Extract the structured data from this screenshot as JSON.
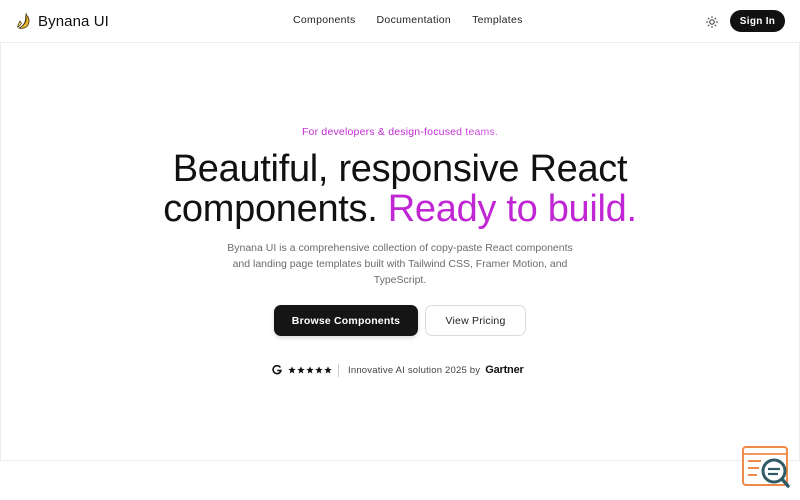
{
  "brand": {
    "name": "Bynana UI",
    "logo_icon": "banana-logo-icon"
  },
  "nav": {
    "links": [
      {
        "label": "Components"
      },
      {
        "label": "Documentation"
      },
      {
        "label": "Templates"
      }
    ],
    "theme_icon": "sun-icon",
    "signin_label": "Sign In"
  },
  "hero": {
    "tagline": "For developers & design-focused teams.",
    "headline_line1": "Beautiful, responsive React",
    "headline_line2_plain": "components.",
    "headline_line2_accent": "Ready to build.",
    "description": "Bynana UI is a comprehensive collection of copy-paste React components and landing page templates built with Tailwind CSS, Framer Motion, and TypeScript.",
    "primary_cta": "Browse Components",
    "secondary_cta": "View Pricing"
  },
  "rating": {
    "source_icon": "g2-icon",
    "stars": 5,
    "text": "Innovative AI solution 2025 by",
    "partner": "Gartner"
  },
  "widget": {
    "icon": "search-chat-icon"
  },
  "colors": {
    "accent": "#c026d3",
    "primary_button": "#151515",
    "text_muted": "#6b6b6b",
    "border": "#ececec",
    "widget_orange": "#f08a4b",
    "widget_teal": "#2f5b67"
  }
}
